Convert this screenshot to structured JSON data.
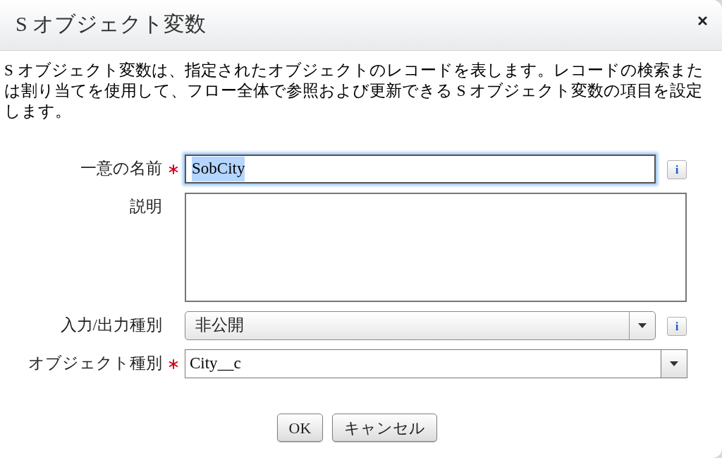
{
  "dialog": {
    "title": "S オブジェクト変数",
    "description": "S オブジェクト変数は、指定されたオブジェクトのレコードを表します。レコードの検索または割り当てを使用して、フロー全体で参照および更新できる S オブジェクト変数の項目を設定します。"
  },
  "fields": [
    {
      "kind": "text",
      "label": "一意の名前",
      "required": true,
      "value": "SobCity",
      "focused": true,
      "help": "i"
    },
    {
      "kind": "textarea",
      "label": "説明",
      "required": false
    },
    {
      "kind": "select",
      "label": "入力/出力種別",
      "required": false,
      "value": "非公開",
      "help": "i"
    },
    {
      "kind": "combobox",
      "label": "オブジェクト種別",
      "required": true,
      "value": "City__c"
    }
  ],
  "buttons": [
    {
      "label": "OK"
    },
    {
      "label": "キャンセル"
    }
  ]
}
